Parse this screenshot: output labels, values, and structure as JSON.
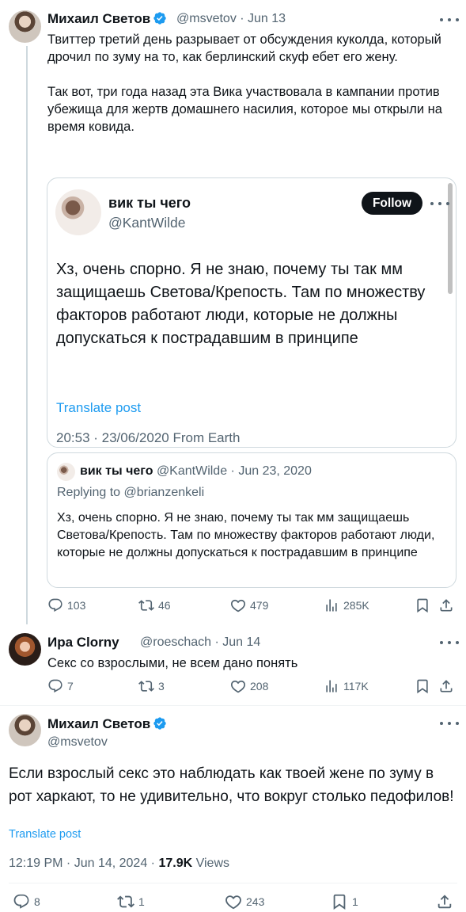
{
  "tweet1": {
    "name": "Михаил Светов",
    "handle": "@msvetov",
    "date": "Jun 13",
    "text": "Твиттер третий день разрывает от обсуждения куколда, который дрочил по зуму на то, как берлинский скуф ебет его жену.\n\nТак вот, три года назад эта Вика участвовала в кампании против убежища для жертв домашнего насилия, которое мы открыли на время ковида.",
    "embed": {
      "name": "вик ты чего",
      "handle": "@KantWilde",
      "follow_label": "Follow",
      "text": "Хз, очень спорно. Я не знаю, почему ты так мм защищаешь Светова/Крепость. Там по множеству факторов работают люди, которые не должны допускаться к пострадавшим в принципе",
      "translate": "Translate post",
      "timestamp": "20:53 · 23/06/2020 From Earth"
    },
    "quote": {
      "name": "вик ты чего",
      "handle": "@KantWilde",
      "date": "Jun 23, 2020",
      "replying_label": "Replying to",
      "replying_to": "@brianzenkeli",
      "text": "Хз, очень спорно. Я не знаю, почему ты так мм защищаешь Светова/Крепость. Там по множеству факторов работают люди, которые не должны допускаться к пострадавшим в принципе"
    },
    "actions": {
      "replies": "103",
      "retweets": "46",
      "likes": "479",
      "views": "285K"
    }
  },
  "tweet2": {
    "name": "Ира Clorny",
    "handle": "@roeschach",
    "date": "Jun 14",
    "text": "Секс со взрослыми, не всем дано понять",
    "actions": {
      "replies": "7",
      "retweets": "3",
      "likes": "208",
      "views": "117K"
    }
  },
  "tweet3": {
    "name": "Михаил Светов",
    "handle": "@msvetov",
    "text": "Если взрослый секс это наблюдать как твоей жене по зуму в рот харкают, то не удивительно, что вокруг столько педофилов!",
    "translate": "Translate post",
    "time": "12:19 PM",
    "date": "Jun 14, 2024",
    "views_count": "17.9K",
    "views_label": "Views",
    "actions": {
      "replies": "8",
      "retweets": "1",
      "likes": "243",
      "bookmarks": "1"
    }
  },
  "icons": [
    "verified-badge-icon",
    "more-icon",
    "reply-icon",
    "retweet-icon",
    "like-icon",
    "views-icon",
    "bookmark-icon",
    "share-icon"
  ],
  "colors": {
    "link": "#1d9bf0",
    "verified": "#1d9bf0",
    "secondary_text": "#536471",
    "border": "#cfd9de"
  }
}
